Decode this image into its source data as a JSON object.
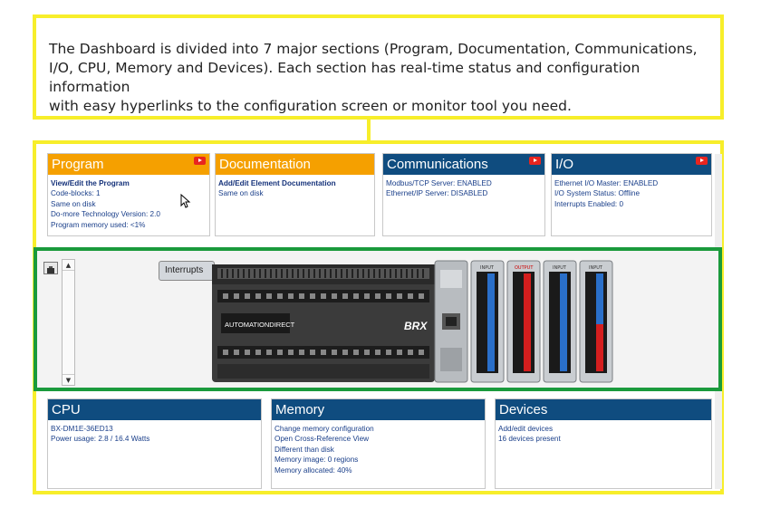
{
  "callout": {
    "line1": "The Dashboard is divided into 7 major sections (Program, Documentation, Communications,",
    "line2": "I/O, CPU, Memory and Devices). Each section has real-time status and configuration information",
    "line3": "with easy hyperlinks to the configuration screen or monitor tool you need."
  },
  "panels": {
    "program": {
      "title": "Program",
      "lines": [
        "View/Edit the Program",
        "Code-blocks: 1",
        "Same on disk",
        "Do-more Technology Version: 2.0",
        "Program memory used: <1%"
      ]
    },
    "documentation": {
      "title": "Documentation",
      "lines": [
        "Add/Edit Element Documentation",
        "Same on disk"
      ]
    },
    "communications": {
      "title": "Communications",
      "lines": [
        "Modbus/TCP Server: ENABLED",
        "Ethernet/IP Server: DISABLED"
      ]
    },
    "io": {
      "title": "I/O",
      "lines": [
        "Ethernet I/O Master: ENABLED",
        "I/O System Status: Offline",
        "Interrupts Enabled: 0"
      ]
    },
    "cpu": {
      "title": "CPU",
      "lines": [
        "BX-DM1E-36ED13",
        "Power usage: 2.8 / 16.4 Watts"
      ]
    },
    "memory": {
      "title": "Memory",
      "lines": [
        "Change memory configuration",
        "Open Cross-Reference View",
        "Different than disk",
        "Memory image: 0 regions",
        "Memory allocated: 40%"
      ]
    },
    "devices": {
      "title": "Devices",
      "lines": [
        "Add/edit devices",
        "16 devices present"
      ]
    }
  },
  "hardware": {
    "interrupts_tab": "Interrupts",
    "brand_label": "AUTOMATIONDIRECT",
    "plc_logo": "BRX",
    "module_labels": [
      "INPUT",
      "OUTPUT",
      "INPUT",
      "INPUT"
    ]
  },
  "colors": {
    "callout_border": "#f7ee2a",
    "hardware_border": "#1a9a3c",
    "header_orange": "#f5a000",
    "header_blue": "#0f4c7f",
    "link_text": "#1a3f8a"
  }
}
